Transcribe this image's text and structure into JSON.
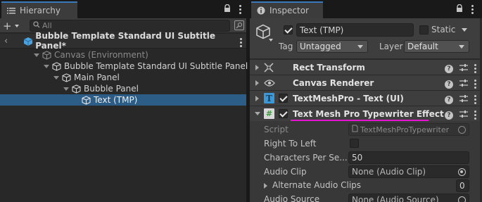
{
  "hierarchy": {
    "tab_label": "Hierarchy",
    "search_placeholder": "All",
    "plus_label": "+",
    "scene_name": "Bubble Template Standard UI Subtitle Panel*",
    "tree": [
      {
        "label": "Canvas (Environment)",
        "indent": 1,
        "dimmed": true,
        "selected": false
      },
      {
        "label": "Bubble Template Standard UI Subtitle Panel",
        "indent": 2,
        "dimmed": false,
        "selected": false
      },
      {
        "label": "Main Panel",
        "indent": 3,
        "dimmed": false,
        "selected": false
      },
      {
        "label": "Bubble Panel",
        "indent": 4,
        "dimmed": false,
        "selected": false
      },
      {
        "label": "Text (TMP)",
        "indent": 5,
        "dimmed": false,
        "selected": true
      }
    ]
  },
  "inspector": {
    "tab_label": "Inspector",
    "object_name": "Text (TMP)",
    "static_label": "Static",
    "tag_label": "Tag",
    "tag_value": "Untagged",
    "layer_label": "Layer",
    "layer_value": "Default",
    "components": [
      {
        "name": "Rect Transform",
        "icon": "rect-transform-icon",
        "has_checkbox": false,
        "expanded": false
      },
      {
        "name": "Canvas Renderer",
        "icon": "eye-icon",
        "has_checkbox": false,
        "expanded": false
      },
      {
        "name": "TextMeshPro - Text (UI)",
        "icon": "tmp-text-icon",
        "has_checkbox": true,
        "expanded": false
      },
      {
        "name": "Text Mesh Pro Typewriter Effect",
        "icon": "script-icon",
        "has_checkbox": true,
        "expanded": true
      }
    ],
    "properties": {
      "script_label": "Script",
      "script_value": "TextMeshProTypewriter",
      "right_to_left_label": "Right To Left",
      "chars_per_sec_label": "Characters Per Se...",
      "chars_per_sec_value": "50",
      "audio_clip_label": "Audio Clip",
      "audio_clip_value": "None (Audio Clip)",
      "alt_audio_label": "Alternate Audio Clips",
      "alt_audio_value": "0",
      "audio_source_label": "Audio Source",
      "audio_source_value": "None (Audio Source)"
    }
  },
  "colors": {
    "selection": "#2c5d87",
    "tab_accent": "#3a79bb",
    "highlight_underline": "#e614d2"
  }
}
